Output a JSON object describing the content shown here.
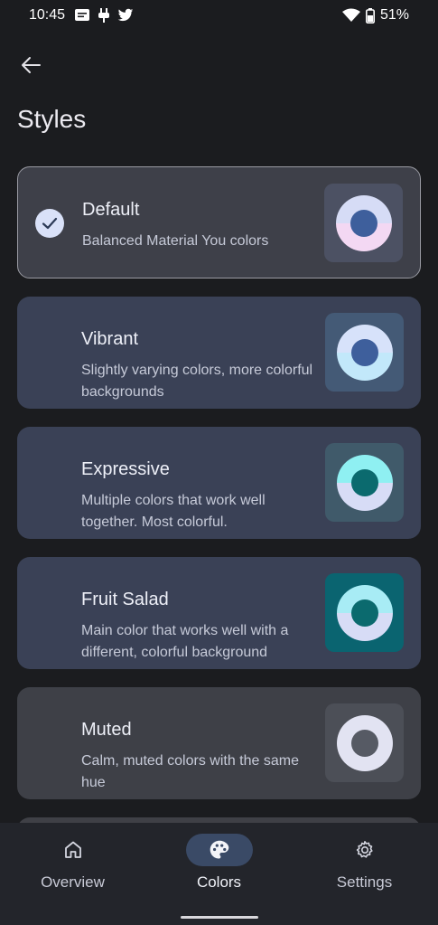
{
  "status_bar": {
    "time": "10:45",
    "battery": "51%"
  },
  "header": {
    "title": "Styles"
  },
  "styles": [
    {
      "name": "Default",
      "description": "Balanced Material You colors",
      "selected": true,
      "card_bg": "#3e4049",
      "swatch_bg": "#4c5163",
      "ring_top": "#d6dcf6",
      "ring_bottom": "#f3d8f3",
      "dot": "#3e5f9c"
    },
    {
      "name": "Vibrant",
      "description": "Slightly varying colors, more colorful backgrounds",
      "selected": false,
      "card_bg": "#3a4156",
      "swatch_bg": "#445a76",
      "ring_top": "#d7e2fa",
      "ring_bottom": "#c2e8fa",
      "dot": "#3e5f9c"
    },
    {
      "name": "Expressive",
      "description": "Multiple colors that work well together. Most colorful.",
      "selected": false,
      "card_bg": "#3a4156",
      "swatch_bg": "#405a6a",
      "ring_top": "#8ff0f2",
      "ring_bottom": "#d7dcf6",
      "dot": "#0b6a6e"
    },
    {
      "name": "Fruit Salad",
      "description": "Main color that works well with a different, colorful background",
      "selected": false,
      "card_bg": "#3a4156",
      "swatch_bg": "#0a6470",
      "ring_top": "#a8ecf5",
      "ring_bottom": "#d7dcf6",
      "dot": "#0b6a6e"
    },
    {
      "name": "Muted",
      "description": "Calm, muted colors with the same hue",
      "selected": false,
      "card_bg": "#3e4047",
      "swatch_bg": "#4c4f57",
      "ring_top": "#e2e3f2",
      "ring_bottom": "#e2e3f2",
      "dot": "#565a64"
    }
  ],
  "nav": {
    "items": [
      {
        "label": "Overview",
        "icon": "home-icon",
        "active": false
      },
      {
        "label": "Colors",
        "icon": "palette-icon",
        "active": true
      },
      {
        "label": "Settings",
        "icon": "gear-icon",
        "active": false
      }
    ]
  }
}
